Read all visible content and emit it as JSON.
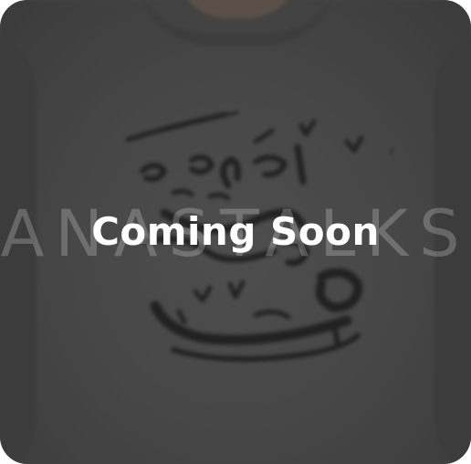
{
  "card": {
    "watermark_text": "ANASTALKS",
    "status_text": "Coming Soon"
  },
  "colors": {
    "overlay": "#3c3c3c",
    "shirt": "#4e4e4e",
    "print": "#111111",
    "text": "#ffffff"
  },
  "icons": {
    "print_design": "arabic-calligraphy-print"
  }
}
